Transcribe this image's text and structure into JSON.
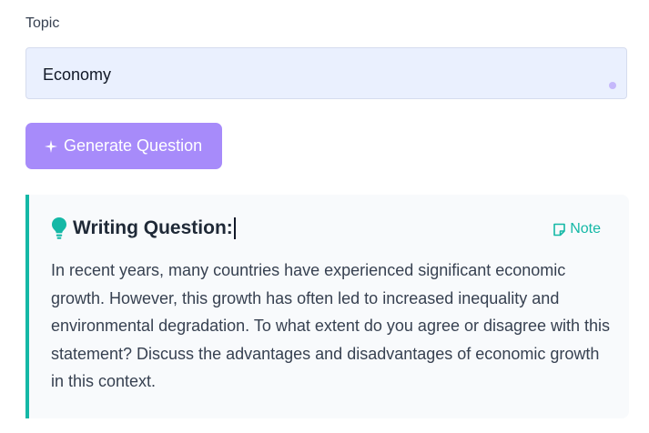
{
  "topic": {
    "label": "Topic",
    "value": "Economy"
  },
  "generate_button": {
    "label": "Generate Question",
    "icon": "sparkle-icon",
    "color": "#a78bfa"
  },
  "question_card": {
    "title": "Writing Question:",
    "title_icon": "lightbulb-icon",
    "note_label": "Note",
    "note_icon": "note-icon",
    "accent_color": "#14b8a6",
    "body": "In recent years, many countries have experienced significant economic growth. However, this growth has often led to increased inequality and environmental degradation. To what extent do you agree or disagree with this statement? Discuss the advantages and disadvantages of economic growth in this context."
  }
}
